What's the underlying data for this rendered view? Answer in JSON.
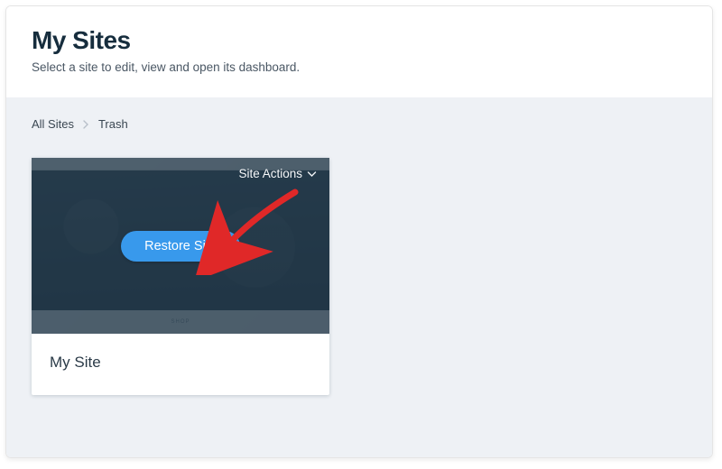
{
  "header": {
    "title": "My Sites",
    "subtitle": "Select a site to edit, view and open its dashboard."
  },
  "breadcrumb": {
    "root": "All Sites",
    "current": "Trash"
  },
  "card": {
    "site_actions_label": "Site Actions",
    "restore_label": "Restore Site",
    "site_name": "My Site",
    "thumb_label": "SHOP"
  }
}
